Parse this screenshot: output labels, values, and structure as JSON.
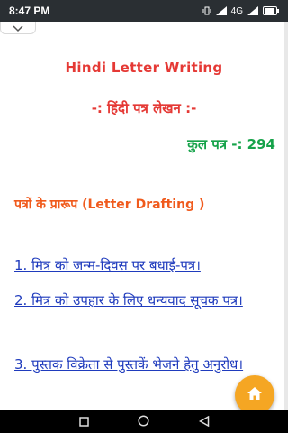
{
  "status_bar": {
    "time": "8:47 PM",
    "network": "4G"
  },
  "header": {
    "title_en": "Hindi Letter Writing",
    "title_hi": "-: हिंदी पत्र लेखन :-",
    "count_label": "कुल पत्र -: 294"
  },
  "section": {
    "heading": "पत्रों के प्रारूप (Letter Drafting )"
  },
  "letters": [
    {
      "label": "1. मित्र को जन्म-दिवस पर बधाई-पत्र।"
    },
    {
      "label": "2. मित्र को उपहार के लिए धन्यवाद सूचक पत्र।"
    },
    {
      "label": "3. पुस्तक विक्रेता से पुस्तकें भेजने हेतु अनुरोध।"
    }
  ],
  "icons": {
    "collapse": "chevron-down-icon",
    "fab": "home-icon",
    "nav": [
      "square-icon",
      "circle-icon",
      "triangle-back-icon"
    ]
  },
  "colors": {
    "title": "#e53935",
    "count": "#16a34a",
    "heading": "#f05a1c",
    "link": "#1f3bbd",
    "fab": "#f5a623"
  }
}
